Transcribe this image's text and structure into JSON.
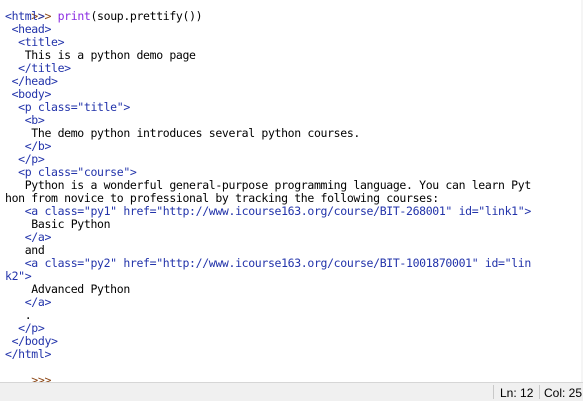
{
  "shell": {
    "prompt": ">>> ",
    "command_builtin": "print",
    "command_rest": "(soup.prettify())",
    "output_lines": [
      "<html>",
      " <head>",
      "  <title>",
      "   This is a python demo page",
      "  </title>",
      " </head>",
      " <body>",
      "  <p class=\"title\">",
      "   <b>",
      "    The demo python introduces several python courses.",
      "   </b>",
      "  </p>",
      "  <p class=\"course\">",
      "   Python is a wonderful general-purpose programming language. You can learn Pyt",
      "hon from novice to professional by tracking the following courses:",
      "   <a class=\"py1\" href=\"http://www.icourse163.org/course/BIT-268001\" id=\"link1\">",
      "    Basic Python",
      "   </a>",
      "   and",
      "   <a class=\"py2\" href=\"http://www.icourse163.org/course/BIT-1001870001\" id=\"lin",
      "k2\">",
      "    Advanced Python",
      "   </a>",
      "   .",
      "  </p>",
      " </body>",
      "</html>"
    ],
    "final_prompt": ">>> "
  },
  "statusbar": {
    "line": "Ln: 12",
    "col": "Col: 25"
  },
  "colors": {
    "tag_text": "#2233aa",
    "plain_text": "#000000",
    "prompt": "#8b4513",
    "builtin": "#8a2be2",
    "statusbar_bg": "#f0f0f0"
  }
}
